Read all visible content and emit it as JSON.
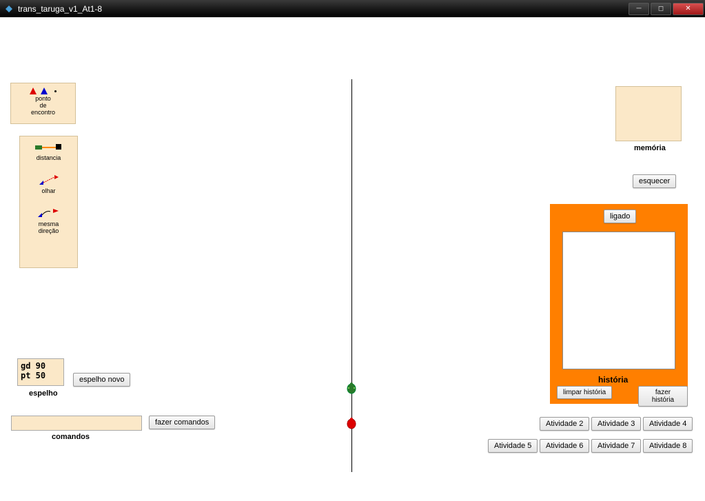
{
  "window": {
    "title": "trans_taruga_v1_At1-8"
  },
  "palette1": {
    "label": "ponto\nde\nencontro"
  },
  "palette2": {
    "tool1": "distancia",
    "tool2": "olhar",
    "tool3": "mesma\ndireção"
  },
  "espelho": {
    "text": "gd 90\npt 50",
    "label": "espelho",
    "novo_btn": "espelho novo"
  },
  "comandos": {
    "value": "",
    "label": "comandos",
    "fazer_btn": "fazer comandos"
  },
  "memoria": {
    "label": "memória",
    "esquecer_btn": "esquecer"
  },
  "historia": {
    "ligado_btn": "ligado",
    "label": "história",
    "limpar_btn": "limpar história",
    "fazer_btn": "fazer história"
  },
  "atividades": {
    "a2": "Atividade 2",
    "a3": "Atividade 3",
    "a4": "Atividade 4",
    "a5": "Atividade 5",
    "a6": "Atividade 6",
    "a7": "Atividade 7",
    "a8": "Atividade 8"
  }
}
